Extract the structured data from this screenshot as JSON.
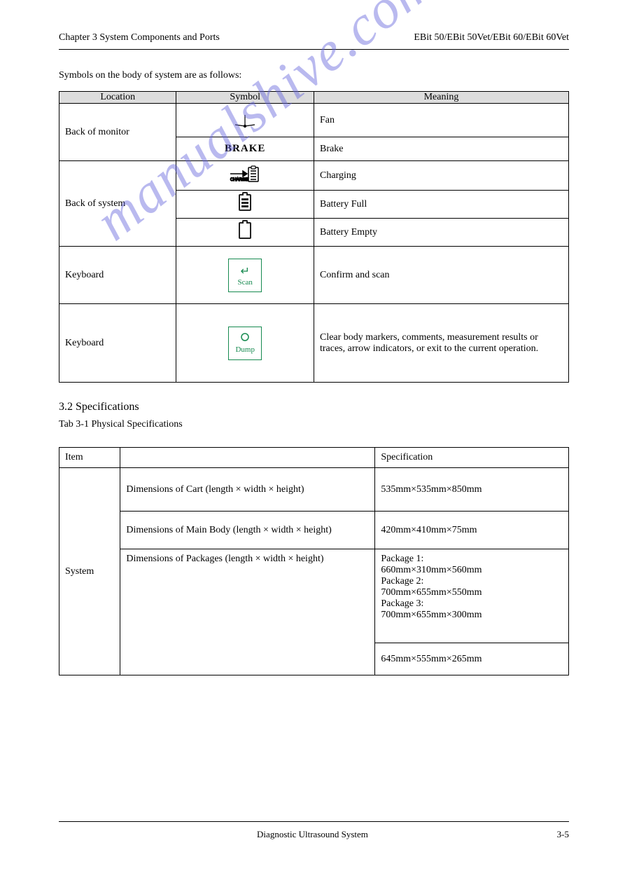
{
  "header": {
    "left": "Chapter 3 System Components and Ports",
    "right": "EBit 50/EBit 50Vet/EBit 60/EBit 60Vet"
  },
  "section1": {
    "title": "Symbols on the body of system are as follows:",
    "headers": [
      "Location",
      "Symbol",
      "Meaning"
    ],
    "rows": [
      {
        "location": "Back of monitor",
        "desc": "Fan"
      },
      {
        "symbol_text": "BRAKE",
        "desc": "Brake"
      },
      {
        "location": "Back of system",
        "desc": "Charging"
      },
      {
        "desc": "Battery Full"
      },
      {
        "desc": "Battery Empty"
      },
      {
        "location": "Keyboard",
        "symbol_text": "Scan",
        "desc": "Confirm and scan"
      },
      {
        "location": "Keyboard",
        "symbol_text": "Dump",
        "desc": "Clear body markers, comments, measurement results or traces, arrow indicators, or exit to the current operation."
      }
    ]
  },
  "section2": {
    "title": "3.2  Specifications",
    "intro": "Tab 3-1 Physical Specifications",
    "headers": [
      "Item",
      "",
      "Specification"
    ],
    "rows": [
      {
        "group": "System",
        "label": "Dimensions of Cart\n(length × width × height)",
        "value": "535mm×535mm×850mm"
      },
      {
        "label": "Dimensions of Main Body\n(length × width × height)",
        "value": "420mm×410mm×75mm"
      },
      {
        "label": "Dimensions of Packages\n(length × width × height)",
        "value": "Package 1:\n660mm×310mm×560mm\nPackage 2:\n700mm×655mm×550mm\nPackage 3:\n700mm×655mm×300mm"
      },
      {
        "value": "645mm×555mm×265mm"
      }
    ]
  },
  "watermark": "manualshive.com",
  "footer": {
    "center": "Diagnostic Ultrasound System",
    "right": "3-5"
  }
}
